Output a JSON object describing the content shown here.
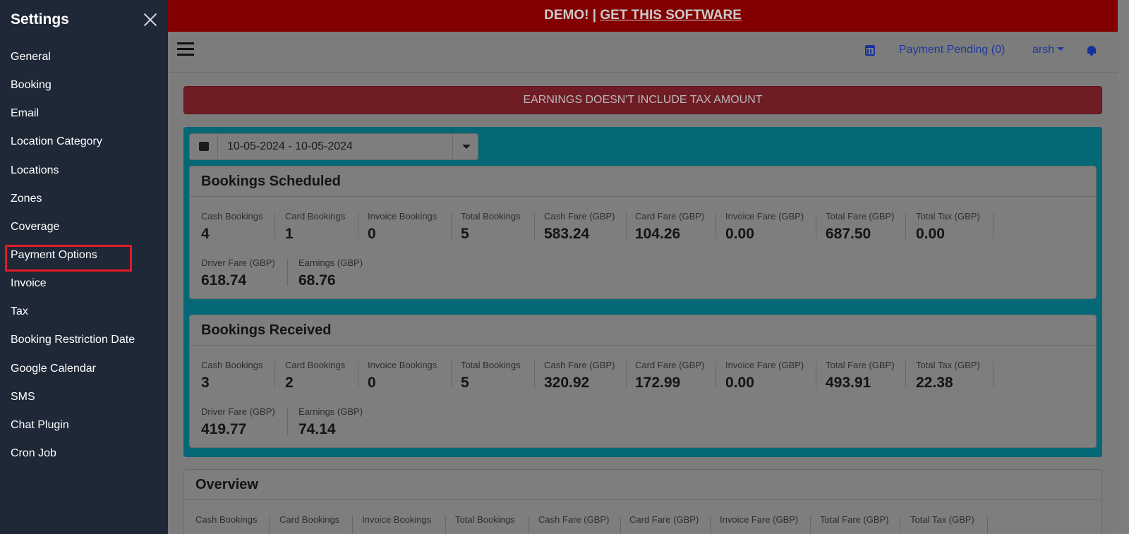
{
  "sidebar": {
    "title": "Settings",
    "items": [
      {
        "label": "General"
      },
      {
        "label": "Booking"
      },
      {
        "label": "Email"
      },
      {
        "label": "Location Category"
      },
      {
        "label": "Locations"
      },
      {
        "label": "Zones"
      },
      {
        "label": "Coverage"
      },
      {
        "label": "Payment Options"
      },
      {
        "label": "Invoice"
      },
      {
        "label": "Tax"
      },
      {
        "label": "Booking Restriction Date"
      },
      {
        "label": "Google Calendar"
      },
      {
        "label": "SMS"
      },
      {
        "label": "Chat Plugin"
      },
      {
        "label": "Cron Job"
      }
    ],
    "highlighted_item": "Payment Options"
  },
  "demo_bar": {
    "prefix": "DEMO! | ",
    "link": "GET THIS SOFTWARE"
  },
  "topbar": {
    "payment_pending": "Payment Pending (0)",
    "user": "arsh"
  },
  "alert": "EARNINGS DOESN'T INCLUDE TAX AMOUNT",
  "date_range": "10-05-2024 - 10-05-2024",
  "scheduled": {
    "title": "Bookings Scheduled",
    "stats": [
      {
        "label": "Cash Bookings",
        "value": "4"
      },
      {
        "label": "Card Bookings",
        "value": "1"
      },
      {
        "label": "Invoice Bookings",
        "value": "0"
      },
      {
        "label": "Total Bookings",
        "value": "5"
      },
      {
        "label": "Cash Fare (GBP)",
        "value": "583.24"
      },
      {
        "label": "Card Fare (GBP)",
        "value": "104.26"
      },
      {
        "label": "Invoice Fare (GBP)",
        "value": "0.00"
      },
      {
        "label": "Total Fare (GBP)",
        "value": "687.50"
      },
      {
        "label": "Total Tax (GBP)",
        "value": "0.00"
      },
      {
        "label": "Driver Fare (GBP)",
        "value": "618.74"
      },
      {
        "label": "Earnings (GBP)",
        "value": "68.76"
      }
    ]
  },
  "received": {
    "title": "Bookings Received",
    "stats": [
      {
        "label": "Cash Bookings",
        "value": "3"
      },
      {
        "label": "Card Bookings",
        "value": "2"
      },
      {
        "label": "Invoice Bookings",
        "value": "0"
      },
      {
        "label": "Total Bookings",
        "value": "5"
      },
      {
        "label": "Cash Fare (GBP)",
        "value": "320.92"
      },
      {
        "label": "Card Fare (GBP)",
        "value": "172.99"
      },
      {
        "label": "Invoice Fare (GBP)",
        "value": "0.00"
      },
      {
        "label": "Total Fare (GBP)",
        "value": "493.91"
      },
      {
        "label": "Total Tax (GBP)",
        "value": "22.38"
      },
      {
        "label": "Driver Fare (GBP)",
        "value": "419.77"
      },
      {
        "label": "Earnings (GBP)",
        "value": "74.14"
      }
    ]
  },
  "overview": {
    "title": "Overview",
    "labels": [
      "Cash Bookings",
      "Card Bookings",
      "Invoice Bookings",
      "Total Bookings",
      "Cash Fare (GBP)",
      "Card Fare (GBP)",
      "Invoice Fare (GBP)",
      "Total Fare (GBP)",
      "Total Tax (GBP)"
    ]
  }
}
